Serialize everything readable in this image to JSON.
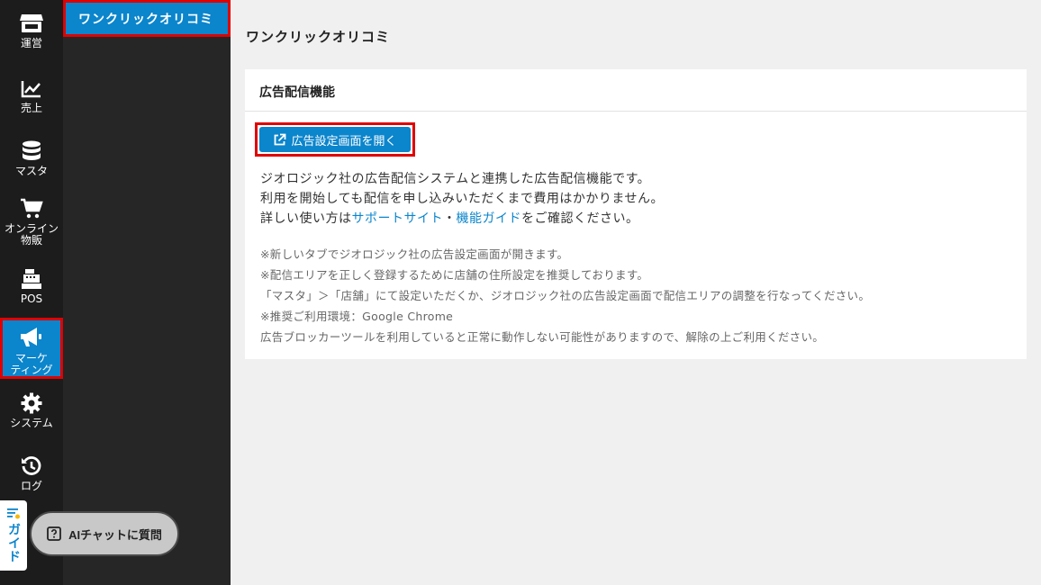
{
  "rail": {
    "items": [
      {
        "label": "運営",
        "icon": "store-icon"
      },
      {
        "label": "売上",
        "icon": "chart-line-icon"
      },
      {
        "label": "マスタ",
        "icon": "database-icon"
      },
      {
        "label_line1": "オンライン",
        "label_line2": "物販",
        "icon": "cart-icon"
      },
      {
        "label": "POS",
        "icon": "cash-register-icon"
      },
      {
        "label_line1": "マーケ",
        "label_line2": "ティング",
        "icon": "megaphone-icon",
        "active": true
      },
      {
        "label": "システム",
        "icon": "gear-icon"
      },
      {
        "label": "ログ",
        "icon": "history-icon"
      }
    ]
  },
  "submenu": {
    "items": [
      {
        "label": "ワンクリックオリコミ",
        "active": true
      }
    ]
  },
  "guide_tab": {
    "label": "ガイド"
  },
  "ai_chat": {
    "label": "AIチャットに質問"
  },
  "main": {
    "title": "ワンクリックオリコミ",
    "card": {
      "header": "広告配信機能",
      "open_button": "広告設定画面を開く",
      "desc_line1": "ジオロジック社の広告配信システムと連携した広告配信機能です。",
      "desc_line2": "利用を開始しても配信を申し込みいただくまで費用はかかりません。",
      "desc_line3_prefix": "詳しい使い方は",
      "support_link": "サポートサイト",
      "separator": "・",
      "guide_link": "機能ガイド",
      "desc_line3_suffix": "をご確認ください。",
      "notes": [
        "※新しいタブでジオロジック社の広告設定画面が開きます。",
        "※配信エリアを正しく登録するために店舗の住所設定を推奨しております。",
        "「マスタ」＞「店舗」にて設定いただくか、ジオロジック社の広告設定画面で配信エリアの調整を行なってください。",
        "※推奨ご利用環境：Google Chrome",
        "広告ブロッカーツールを利用していると正常に動作しない可能性がありますので、解除の上ご利用ください。"
      ]
    }
  },
  "colors": {
    "accent": "#0b85cc",
    "highlight": "#e00000",
    "rail_bg": "#1c1c1c"
  }
}
